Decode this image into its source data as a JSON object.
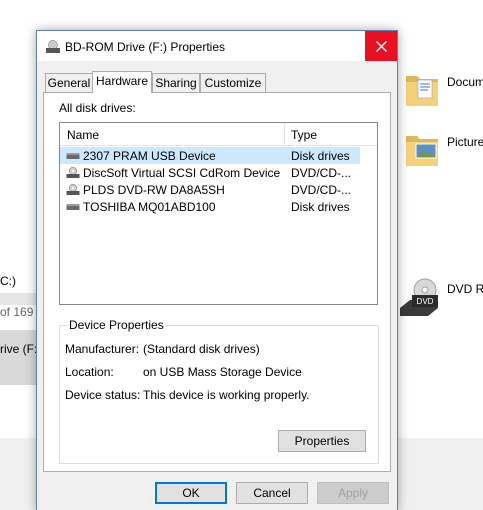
{
  "background": {
    "left_drive_c": "C:)",
    "left_of_text": "of 169",
    "left_drive_f": "rive (F:)",
    "right_documents": "Docum",
    "right_pictures": "Picture",
    "right_dvd": "DVD RV",
    "dvd_badge": "DVD"
  },
  "dialog": {
    "title": "BD-ROM Drive (F:) Properties",
    "tabs": [
      "General",
      "Hardware",
      "Sharing",
      "Customize"
    ],
    "active_tab": "Hardware",
    "all_drives_label": "All disk drives:",
    "list": {
      "columns": [
        "Name",
        "Type"
      ],
      "rows": [
        {
          "name": "2307 PRAM USB Device",
          "type": "Disk drives",
          "icon": "disk-drive-icon",
          "selected": true
        },
        {
          "name": "DiscSoft Virtual SCSI CdRom Device",
          "type": "DVD/CD-...",
          "icon": "optical-drive-icon",
          "selected": false
        },
        {
          "name": "PLDS DVD-RW DA8A5SH",
          "type": "DVD/CD-...",
          "icon": "optical-drive-icon",
          "selected": false
        },
        {
          "name": "TOSHIBA MQ01ABD100",
          "type": "Disk drives",
          "icon": "disk-drive-icon",
          "selected": false
        }
      ]
    },
    "device_properties": {
      "legend": "Device Properties",
      "manufacturer_label": "Manufacturer:",
      "manufacturer_value": "(Standard disk drives)",
      "location_label": "Location:",
      "location_value": "on USB Mass Storage Device",
      "status_label": "Device status:",
      "status_value": "This device is working properly.",
      "properties_button": "Properties"
    },
    "buttons": {
      "ok": "OK",
      "cancel": "Cancel",
      "apply": "Apply"
    },
    "colors": {
      "close_red": "#e81123",
      "selection": "#cce8ff",
      "accent": "#0078d7"
    }
  }
}
